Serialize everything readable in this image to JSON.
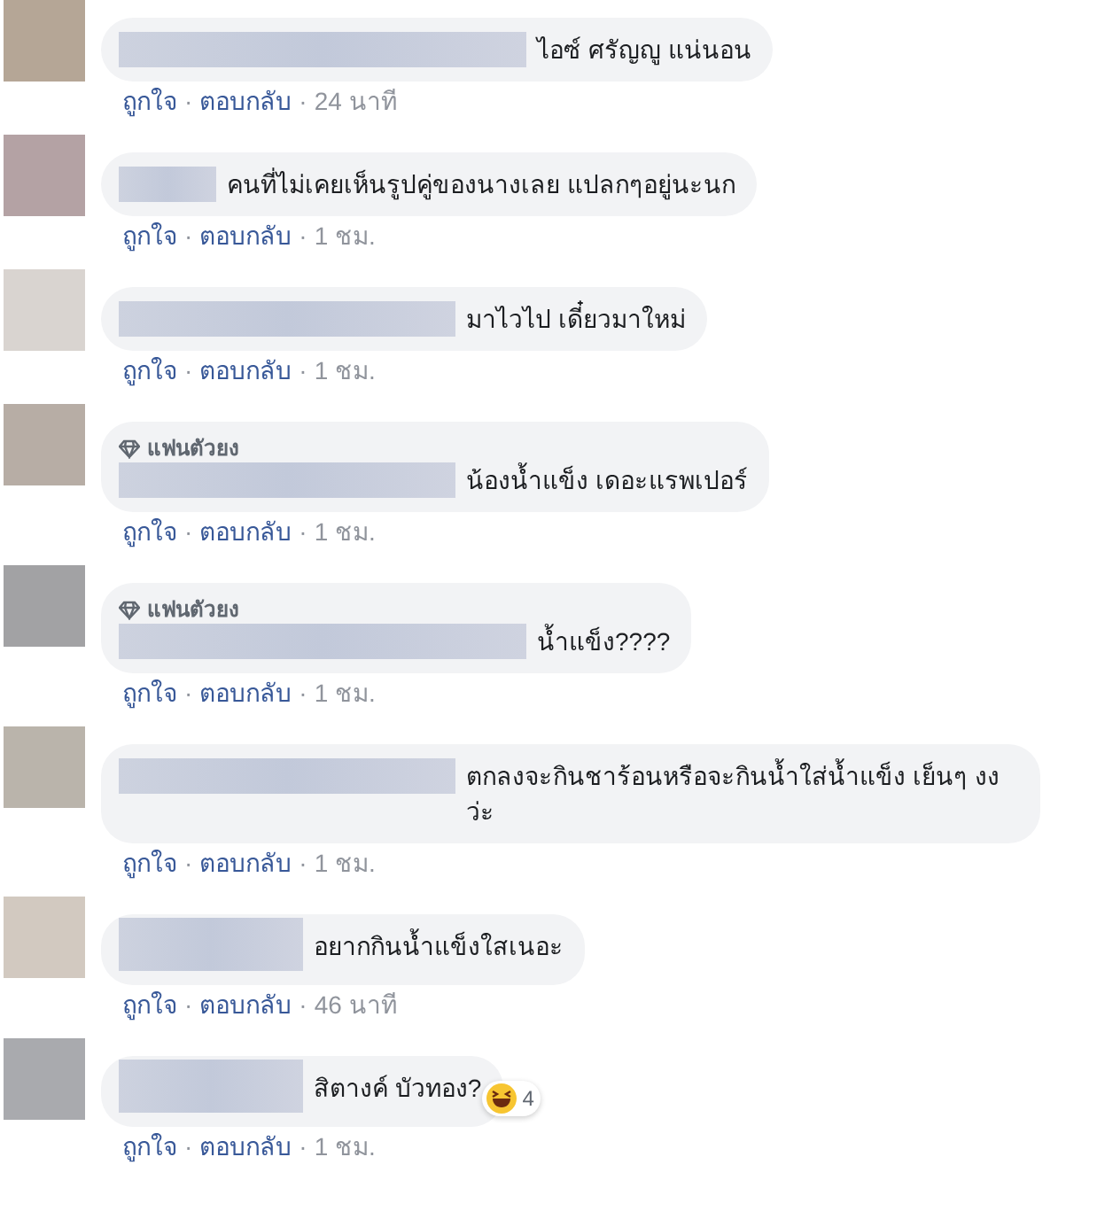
{
  "separator": "·",
  "comments": [
    {
      "text": "ไอซ์ ศรัญญู แน่นอน",
      "like": "ถูกใจ",
      "reply": "ตอบกลับ",
      "time": "24 นาที"
    },
    {
      "text": "คนที่ไม่เคยเห็นรูปคู่ของนางเลย แปลกๆอยู่นะนก",
      "like": "ถูกใจ",
      "reply": "ตอบกลับ",
      "time": "1 ชม."
    },
    {
      "text": "มาไวไป เดี๋ยวมาใหม่",
      "like": "ถูกใจ",
      "reply": "ตอบกลับ",
      "time": "1 ชม."
    },
    {
      "badge": "แฟนตัวยง",
      "text": "น้องน้ำแข็ง เดอะแรพเปอร์",
      "like": "ถูกใจ",
      "reply": "ตอบกลับ",
      "time": "1 ชม."
    },
    {
      "badge": "แฟนตัวยง",
      "text": "น้ำแข็ง????",
      "like": "ถูกใจ",
      "reply": "ตอบกลับ",
      "time": "1 ชม."
    },
    {
      "text": "ตกลงจะกินชาร้อนหรือจะกินน้ำใส่น้ำแข็ง เย็นๆ งงว่ะ",
      "like": "ถูกใจ",
      "reply": "ตอบกลับ",
      "time": "1 ชม."
    },
    {
      "text": "อยากกินน้ำแข็งใสเนอะ",
      "like": "ถูกใจ",
      "reply": "ตอบกลับ",
      "time": "46 นาที"
    },
    {
      "text": "สิตางค์ บัวทอง?",
      "reaction_count": "4",
      "like": "ถูกใจ",
      "reply": "ตอบกลับ",
      "time": "1 ชม."
    }
  ]
}
